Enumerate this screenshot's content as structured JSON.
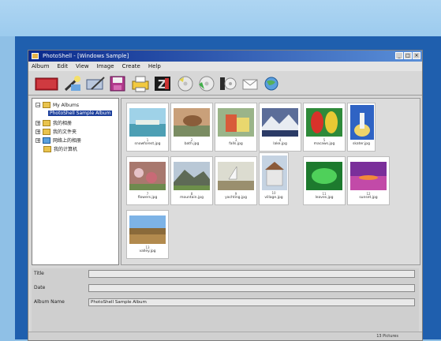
{
  "window": {
    "title": "PhotoShell - [Windows Sample]"
  },
  "menu": [
    "Album",
    "Edit",
    "View",
    "Image",
    "Create",
    "Help"
  ],
  "toolbar": {
    "icons": [
      "album-icon",
      "wand-icon",
      "edit-icon",
      "save-icon",
      "print-icon",
      "zip-icon",
      "cd-icon",
      "cd-burn-icon",
      "slideshow-icon",
      "email-icon",
      "web-icon"
    ]
  },
  "tree": {
    "items": [
      {
        "label": "My Albums",
        "expander": "−"
      },
      {
        "label": "PhotoShell Sample Album",
        "expander": ""
      },
      {
        "label": "我的相册",
        "expander": "+"
      },
      {
        "label": "我的文件夹",
        "expander": "+"
      },
      {
        "label": "网络上的相册",
        "expander": "+"
      },
      {
        "label": "我的计算机",
        "expander": ""
      }
    ]
  },
  "thumbnails": [
    {
      "caption": "snowforest.jpg",
      "index": "1"
    },
    {
      "caption": "bath.jpg",
      "index": "2"
    },
    {
      "caption": "falls.jpg",
      "index": "3"
    },
    {
      "caption": "lake.jpg",
      "index": "4"
    },
    {
      "caption": "macaws.jpg",
      "index": "5"
    },
    {
      "caption": "skater.jpg",
      "index": "6"
    },
    {
      "caption": "flowers.jpg",
      "index": "7"
    },
    {
      "caption": "mountain.jpg",
      "index": "8"
    },
    {
      "caption": "yachting.jpg",
      "index": "9"
    },
    {
      "caption": "village.jpg",
      "index": "10"
    },
    {
      "caption": "leaves.jpg",
      "index": "11"
    },
    {
      "caption": "sunset.jpg",
      "index": "12"
    },
    {
      "caption": "valley.jpg",
      "index": "13"
    }
  ],
  "info": {
    "title_label": "Title",
    "title_value": "",
    "date_label": "Date",
    "date_value": "",
    "album_label": "Album Name",
    "album_value": "PhotoShell Sample Album"
  },
  "status": {
    "text": "13 Pictures"
  }
}
